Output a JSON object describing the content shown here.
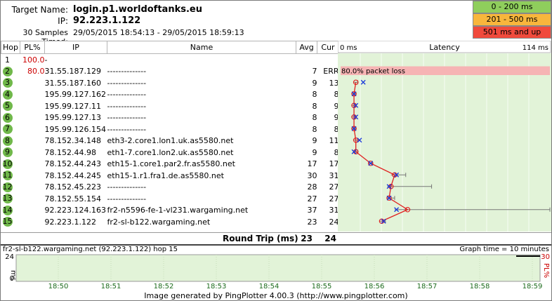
{
  "header": {
    "target_label": "Target Name:",
    "target_value": "login.p1.worldoftanks.eu",
    "ip_label": "IP:",
    "ip_value": "92.223.1.122",
    "samples_label": "30 Samples Timed:",
    "samples_value": "29/05/2015 18:54:13 - 29/05/2015 18:59:13"
  },
  "legend": [
    {
      "label": "0 - 200 ms",
      "color": "#8fce5c"
    },
    {
      "label": "201 - 500 ms",
      "color": "#f8b63c"
    },
    {
      "label": "501 ms and up",
      "color": "#f04a3c"
    }
  ],
  "columns": {
    "hop": "Hop",
    "pl": "PL%",
    "ip": "IP",
    "name": "Name",
    "avg": "Avg",
    "cur": "Cur"
  },
  "latency_header": {
    "min": "0 ms",
    "title": "Latency",
    "max": "114 ms"
  },
  "hops": [
    {
      "hop": "1",
      "pl": "100.0",
      "ip": "-",
      "name": "",
      "avg": "",
      "cur": ""
    },
    {
      "hop": "2",
      "pl": "80.0",
      "ip": "31.55.187.129",
      "name": "--------------",
      "avg": "7",
      "cur": "ERR"
    },
    {
      "hop": "3",
      "pl": "",
      "ip": "31.55.187.160",
      "name": "--------------",
      "avg": "9",
      "cur": "13"
    },
    {
      "hop": "4",
      "pl": "",
      "ip": "195.99.127.162",
      "name": "--------------",
      "avg": "8",
      "cur": "8"
    },
    {
      "hop": "5",
      "pl": "",
      "ip": "195.99.127.11",
      "name": "--------------",
      "avg": "8",
      "cur": "9"
    },
    {
      "hop": "6",
      "pl": "",
      "ip": "195.99.127.13",
      "name": "--------------",
      "avg": "8",
      "cur": "9"
    },
    {
      "hop": "7",
      "pl": "",
      "ip": "195.99.126.154",
      "name": "--------------",
      "avg": "8",
      "cur": "8"
    },
    {
      "hop": "8",
      "pl": "",
      "ip": "78.152.34.148",
      "name": "eth3-2.core1.lon1.uk.as5580.net",
      "avg": "9",
      "cur": "11"
    },
    {
      "hop": "9",
      "pl": "",
      "ip": "78.152.44.98",
      "name": "eth1-7.core1.lon2.uk.as5580.net",
      "avg": "9",
      "cur": "8"
    },
    {
      "hop": "10",
      "pl": "",
      "ip": "78.152.44.243",
      "name": "eth15-1.core1.par2.fr.as5580.net",
      "avg": "17",
      "cur": "17"
    },
    {
      "hop": "11",
      "pl": "",
      "ip": "78.152.44.245",
      "name": "eth15-1.r1.fra1.de.as5580.net",
      "avg": "30",
      "cur": "31"
    },
    {
      "hop": "12",
      "pl": "",
      "ip": "78.152.45.223",
      "name": "--------------",
      "avg": "28",
      "cur": "27"
    },
    {
      "hop": "13",
      "pl": "",
      "ip": "78.152.55.154",
      "name": "--------------",
      "avg": "27",
      "cur": "27"
    },
    {
      "hop": "14",
      "pl": "",
      "ip": "92.223.124.163",
      "name": "fr2-n5596-fe-1-vl231.wargaming.net",
      "avg": "37",
      "cur": "31"
    },
    {
      "hop": "15",
      "pl": "",
      "ip": "92.223.1.122",
      "name": "fr2-sl-b122.wargaming.net",
      "avg": "23",
      "cur": "24"
    }
  ],
  "packet_loss_note": "80.0% packet loss",
  "round_trip": {
    "label": "Round Trip (ms)",
    "avg": "23",
    "cur": "24"
  },
  "time_graph": {
    "title": "fr2-sl-b122.wargaming.net (92.223.1.122) hop 15",
    "graph_time": "Graph time = 10 minutes",
    "y_top": "24",
    "y_bottom": "0",
    "y_unit": "ms",
    "pl_top": "30",
    "pl_unit": "PL%",
    "times": [
      "18:50",
      "18:51",
      "18:52",
      "18:53",
      "18:54",
      "18:55",
      "18:56",
      "18:57",
      "18:58",
      "18:59"
    ]
  },
  "chart_data": {
    "type": "line",
    "title": "Latency",
    "x_label": "",
    "y_label": "",
    "xlim": [
      0,
      114
    ],
    "categories": [
      "3",
      "4",
      "5",
      "6",
      "7",
      "8",
      "9",
      "10",
      "11",
      "12",
      "13",
      "14",
      "15"
    ],
    "series": [
      {
        "name": "Avg",
        "values": [
          9,
          8,
          8,
          8,
          8,
          9,
          9,
          17,
          30,
          28,
          27,
          37,
          23
        ]
      },
      {
        "name": "Cur",
        "values": [
          13,
          8,
          9,
          9,
          8,
          11,
          8,
          17,
          31,
          27,
          27,
          31,
          24
        ]
      }
    ],
    "min_values": [
      8,
      7,
      7,
      7,
      7,
      8,
      8,
      16,
      28,
      26,
      26,
      30,
      22
    ],
    "max_values": [
      10,
      9,
      9,
      9,
      9,
      10,
      10,
      18,
      36,
      50,
      30,
      114,
      25
    ],
    "colors": {
      "zone": "#e2f3d8",
      "line": "#e02020",
      "avg_marker": "#e02020",
      "cur_marker": "#1a3adb",
      "range": "#777777",
      "loss": "#f6b4b4"
    }
  }
}
